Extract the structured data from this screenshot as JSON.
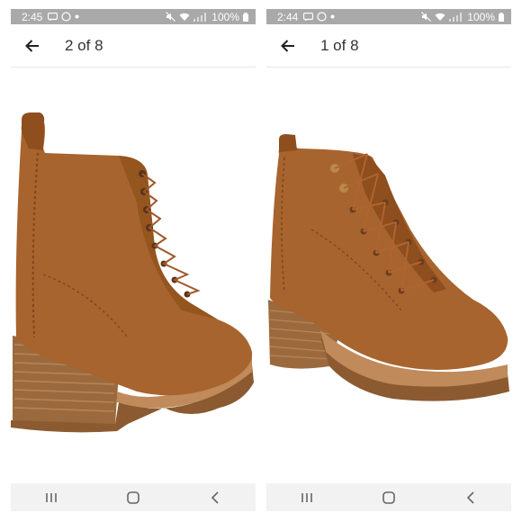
{
  "screens": [
    {
      "status": {
        "time": "2:45",
        "battery": "100%"
      },
      "pager": "2 of 8",
      "image_alt": "Brown suede lace-up boot, rear view"
    },
    {
      "status": {
        "time": "2:44",
        "battery": "100%"
      },
      "pager": "1 of 8",
      "image_alt": "Brown suede lace-up boot, front three-quarter view"
    }
  ],
  "colors": {
    "statusbar_bg": "#a9a9a9",
    "suede": "#a8642e",
    "suede_dark": "#7f461c",
    "sole": "#c08a5a",
    "navbar_bg": "#f2f2f2"
  },
  "icons": [
    "back-arrow-icon",
    "recents-icon",
    "home-icon",
    "back-nav-icon"
  ]
}
